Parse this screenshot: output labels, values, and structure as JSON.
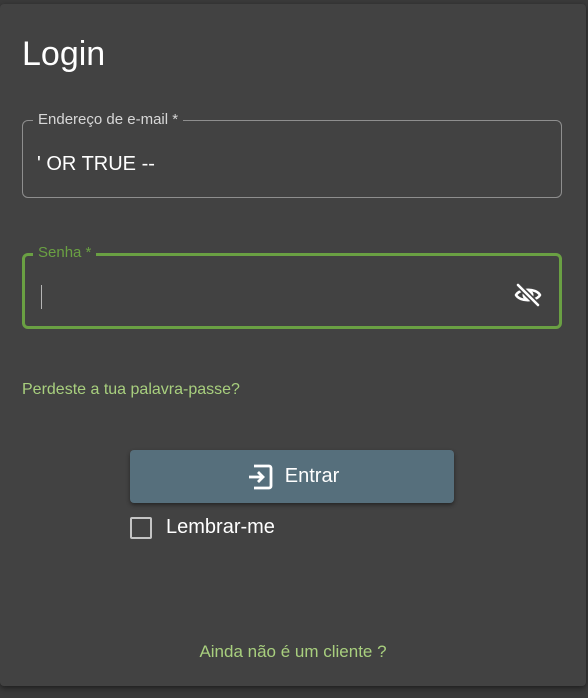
{
  "page": {
    "title": "Login"
  },
  "email_field": {
    "label": "Endereço de e-mail *",
    "value": "' OR TRUE --"
  },
  "password_field": {
    "label": "Senha *",
    "value": "",
    "toggle_icon": "eye-off-icon"
  },
  "links": {
    "forgot_password": "Perdeste a tua palavra-passe?",
    "signup": "Ainda não é um cliente ?"
  },
  "submit": {
    "label": "Entrar",
    "icon": "login-icon"
  },
  "remember_me": {
    "label": "Lembrar-me",
    "checked": false
  },
  "colors": {
    "background": "#424242",
    "accent_green": "#6aa043",
    "link_green": "#a8cf7e",
    "button": "#566f7c"
  }
}
